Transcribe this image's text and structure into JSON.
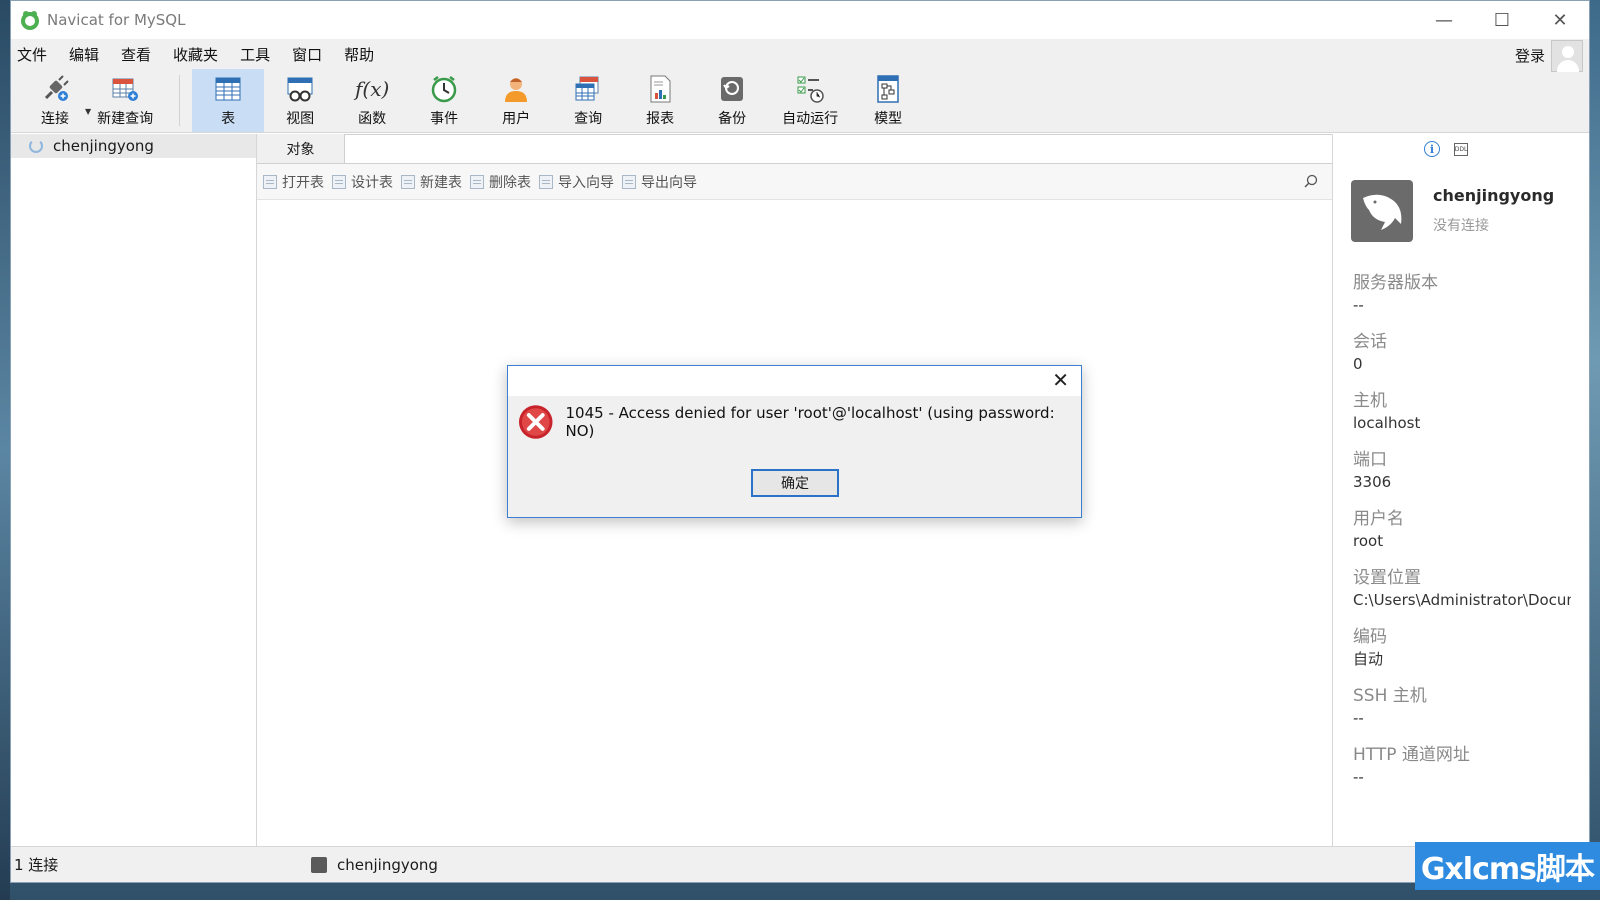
{
  "window": {
    "title": "Navicat for MySQL",
    "controls": {
      "minimize": "—",
      "maximize": "☐",
      "close": "✕"
    }
  },
  "menu": {
    "items": [
      "文件",
      "编辑",
      "查看",
      "收藏夹",
      "工具",
      "窗口",
      "帮助"
    ],
    "login": "登录"
  },
  "toolbar": {
    "connect": "连接",
    "new_query": "新建查询",
    "table": "表",
    "view": "视图",
    "function": "函数",
    "event": "事件",
    "user": "用户",
    "query": "查询",
    "report": "报表",
    "backup": "备份",
    "automation": "自动运行",
    "model": "模型",
    "function_icon_text": "f(x)"
  },
  "sidebar": {
    "connection": "chenjingyong"
  },
  "main": {
    "tab": "对象",
    "actions": [
      "打开表",
      "设计表",
      "新建表",
      "删除表",
      "导入向导",
      "导出向导"
    ]
  },
  "info_panel": {
    "name": "chenjingyong",
    "status": "没有连接",
    "ddl_icon_text": "DDL",
    "fields": [
      {
        "key": "服务器版本",
        "value": "--"
      },
      {
        "key": "会话",
        "value": "0"
      },
      {
        "key": "主机",
        "value": "localhost"
      },
      {
        "key": "端口",
        "value": "3306"
      },
      {
        "key": "用户名",
        "value": "root"
      },
      {
        "key": "设置位置",
        "value": "C:\\Users\\Administrator\\Docum"
      },
      {
        "key": "编码",
        "value": "自动"
      },
      {
        "key": "SSH 主机",
        "value": "--"
      },
      {
        "key": "HTTP 通道网址",
        "value": "--"
      }
    ]
  },
  "statusbar": {
    "count": "1 连接",
    "connection": "chenjingyong"
  },
  "dialog": {
    "message": "1045 - Access denied for user 'root'@'localhost' (using password: NO)",
    "ok": "确定",
    "close": "✕"
  },
  "watermark": "Gxlcms脚本",
  "colors": {
    "accent": "#2a72c8",
    "toolbar_active": "#c9def5",
    "error": "#c8232b"
  }
}
